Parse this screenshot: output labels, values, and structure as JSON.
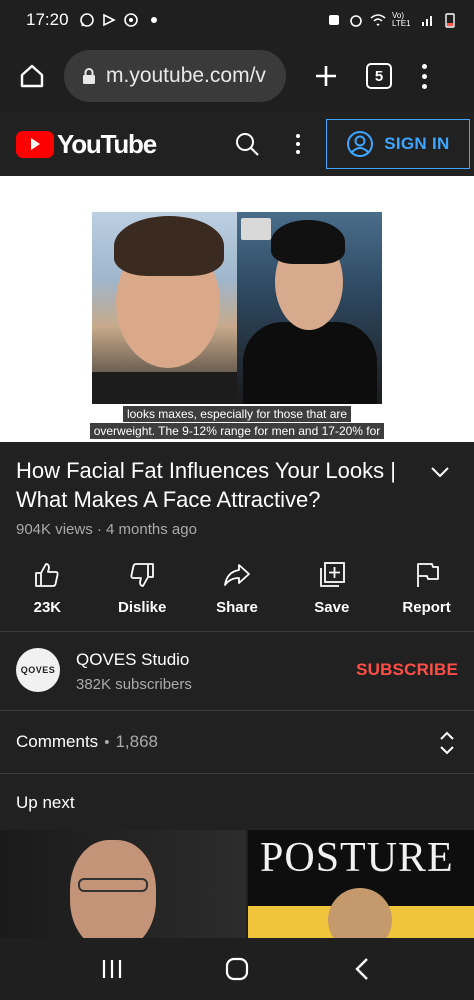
{
  "status_bar": {
    "time": "17:20",
    "left_icons": [
      "whatsapp-icon",
      "youtube-studio-icon",
      "camera-icon"
    ],
    "network_label": "Vo) LTE1",
    "right_icons": [
      "alarm-icon",
      "alarm-clock-icon",
      "wifi-icon",
      "signal-icon",
      "battery-icon"
    ]
  },
  "browser": {
    "url": "m.youtube.com/v",
    "tab_count": "5"
  },
  "yt_header": {
    "logo_text": "YouTube",
    "sign_in_label": "SIGN IN"
  },
  "player": {
    "caption_line1": "looks maxes, especially for those that are",
    "caption_line2": "overweight. The 9-12% range for men and 17-20% for"
  },
  "video": {
    "title": "How Facial Fat Influences Your Looks | What Makes A Face Attractive?",
    "meta": "904K views · 4 months ago"
  },
  "actions": [
    {
      "label": "23K",
      "icon": "like-icon"
    },
    {
      "label": "Dislike",
      "icon": "dislike-icon"
    },
    {
      "label": "Share",
      "icon": "share-icon"
    },
    {
      "label": "Save",
      "icon": "save-icon"
    },
    {
      "label": "Report",
      "icon": "report-icon"
    }
  ],
  "channel": {
    "avatar_text": "QOVES",
    "name": "QOVES Studio",
    "subscribers": "382K subscribers",
    "subscribe_label": "SUBSCRIBE"
  },
  "comments": {
    "label": "Comments",
    "separator": "•",
    "count": "1,868"
  },
  "up_next": {
    "label": "Up next",
    "thumb_right_text": "POSTURE"
  },
  "colors": {
    "background": "#212121",
    "accent_blue": "#3ea6ff",
    "subscribe_red": "#ff4e45",
    "youtube_red": "#ff0000"
  }
}
